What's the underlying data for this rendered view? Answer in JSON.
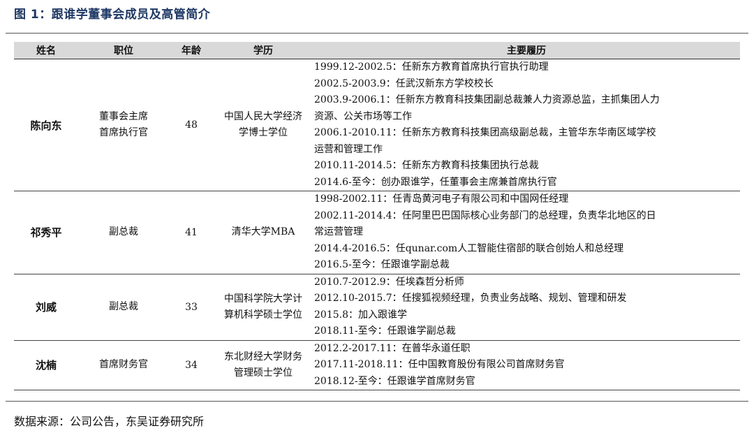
{
  "figure_title": "图 1：跟谁学董事会成员及高管简介",
  "table": {
    "headers": [
      "姓名",
      "职位",
      "年龄",
      "学历",
      "主要履历"
    ],
    "rows": [
      {
        "name": "陈向东",
        "position": [
          "董事会主席",
          "首席执行官"
        ],
        "age": "48",
        "education": [
          "中国人民大学经济",
          "学博士学位"
        ],
        "career": [
          "1999.12-2002.5：任新东方教育首席执行官执行助理",
          "2002.5-2003.9：任武汉新东方学校校长",
          "2003.9-2006.1：任新东方教育科技集团副总裁兼人力资源总监，主抓集团人力",
          "资源、公关市场等工作",
          "2006.1-2010.11：任新东方教育科技集团高级副总裁，主管华东华南区域学校",
          "运营和管理工作",
          "2010.11-2014.5：任新东方教育科技集团执行总裁",
          "2014.6-至今：创办跟谁学，任董事会主席兼首席执行官"
        ]
      },
      {
        "name": "祁秀平",
        "position": [
          "副总裁"
        ],
        "age": "41",
        "education": [
          "清华大学MBA"
        ],
        "career": [
          "1998-2002.11：任青岛黄河电子有限公司和中国网任经理",
          "2002.11-2014.4：任阿里巴巴国际核心业务部门的总经理，负责华北地区的日",
          "常运营管理",
          "2014.4-2016.5：任qunar.com人工智能住宿部的联合创始人和总经理",
          "2016.5-至今：任跟谁学副总裁"
        ]
      },
      {
        "name": "刘威",
        "position": [
          "副总裁"
        ],
        "age": "33",
        "education": [
          "中国科学院大学计",
          "算机科学硕士学位"
        ],
        "career": [
          "2010.7-2012.9：任埃森哲分析师",
          "2012.10-2015.7：任搜狐视频经理，负责业务战略、规划、管理和研发",
          "2015.8：加入跟谁学",
          "2018.11-至今：任跟谁学副总裁"
        ]
      },
      {
        "name": "沈楠",
        "position": [
          "首席财务官"
        ],
        "age": "34",
        "education": [
          "东北财经大学财务",
          "管理硕士学位"
        ],
        "career": [
          "2012.2-2017.11：在普华永道任职",
          "2017.11-2018.11：任中国教育股份有限公司首席财务官",
          "2018.12-至今：任跟谁学首席财务官"
        ]
      }
    ]
  },
  "source": "数据来源：公司公告，东吴证券研究所"
}
